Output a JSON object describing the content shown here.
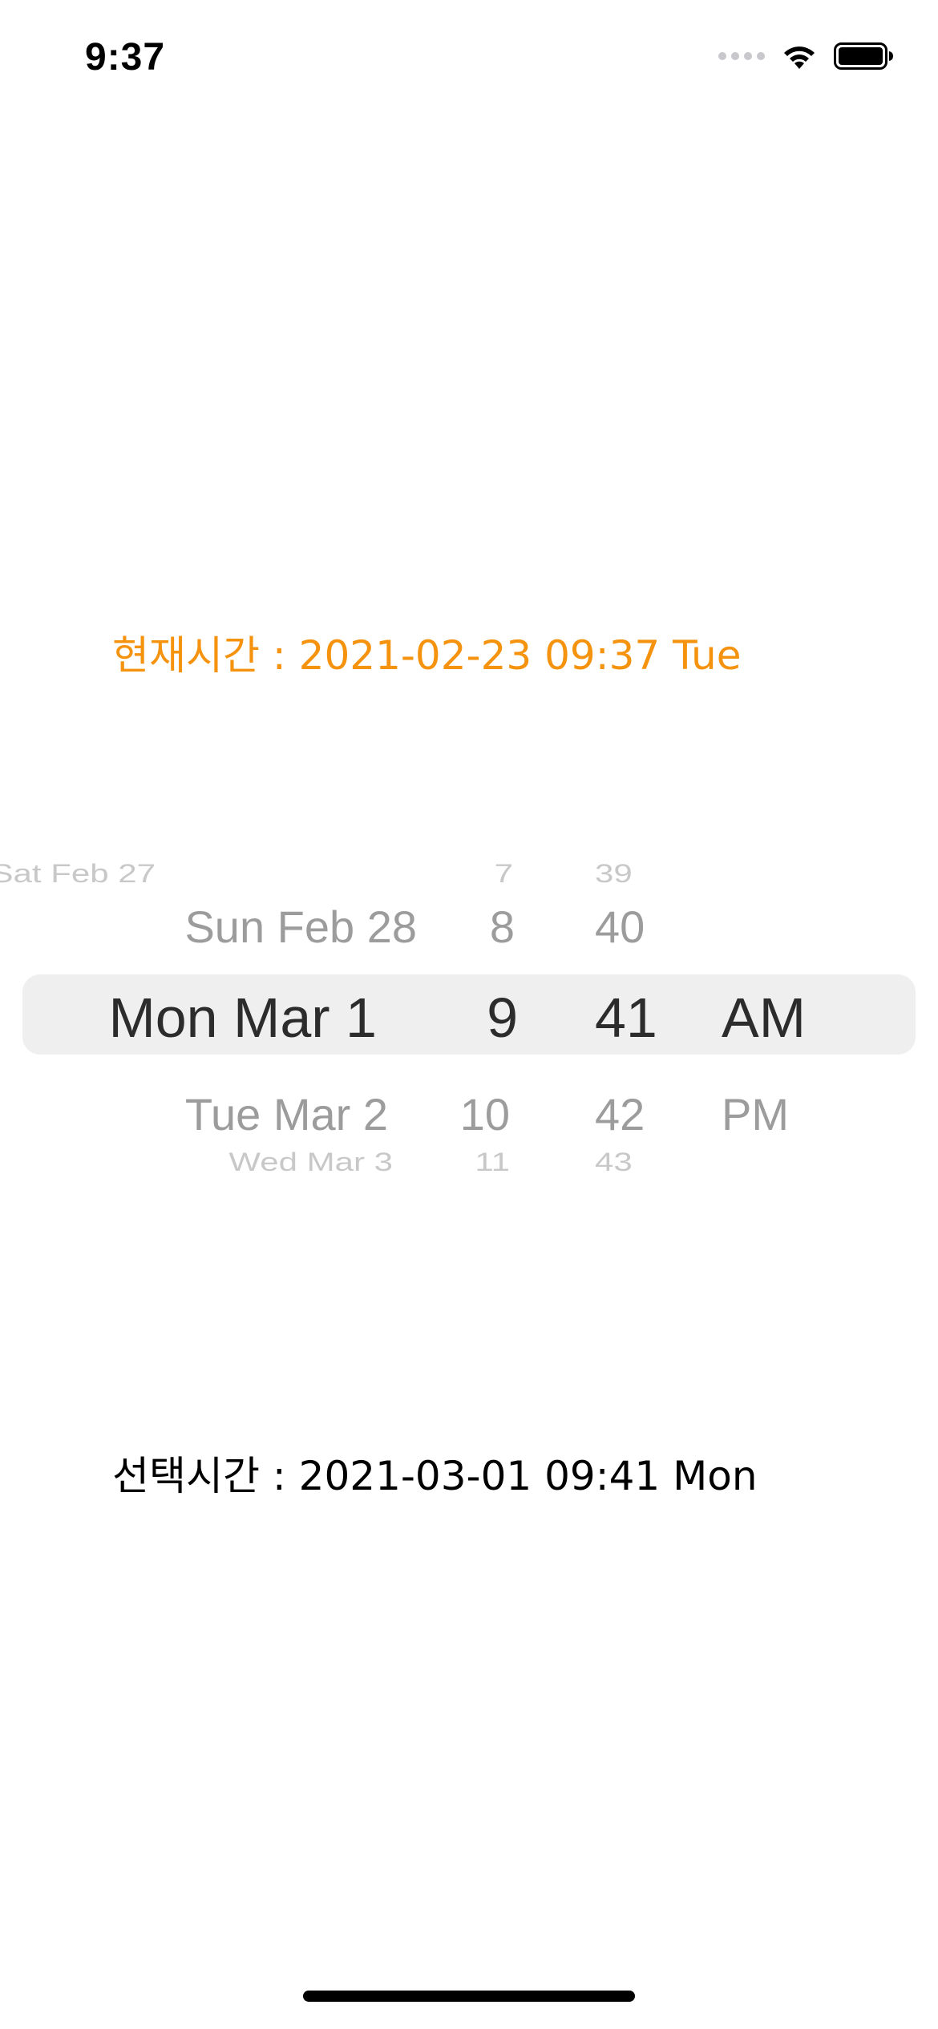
{
  "status_bar": {
    "time": "9:37",
    "icons": [
      "signal-icon",
      "wifi-icon",
      "battery-icon"
    ]
  },
  "current_time": {
    "text": "현재시간 : 2021-02-23 09:37 Tue",
    "color": "#f5920e"
  },
  "picker": {
    "date_column": [
      "Sat Feb 27",
      "Sun Feb 28",
      "Mon Mar 1",
      "Tue Mar 2",
      "Wed Mar 3"
    ],
    "hour_column": [
      "7",
      "8",
      "9",
      "10",
      "11"
    ],
    "minute_column": [
      "39",
      "40",
      "41",
      "42",
      "43"
    ],
    "ampm_column": [
      "AM",
      "PM"
    ],
    "selected": {
      "date": "Mon Mar 1",
      "hour": "9",
      "minute": "41",
      "ampm": "AM"
    }
  },
  "selected_time": {
    "text": "선택시간 : 2021-03-01 09:41 Mon"
  }
}
